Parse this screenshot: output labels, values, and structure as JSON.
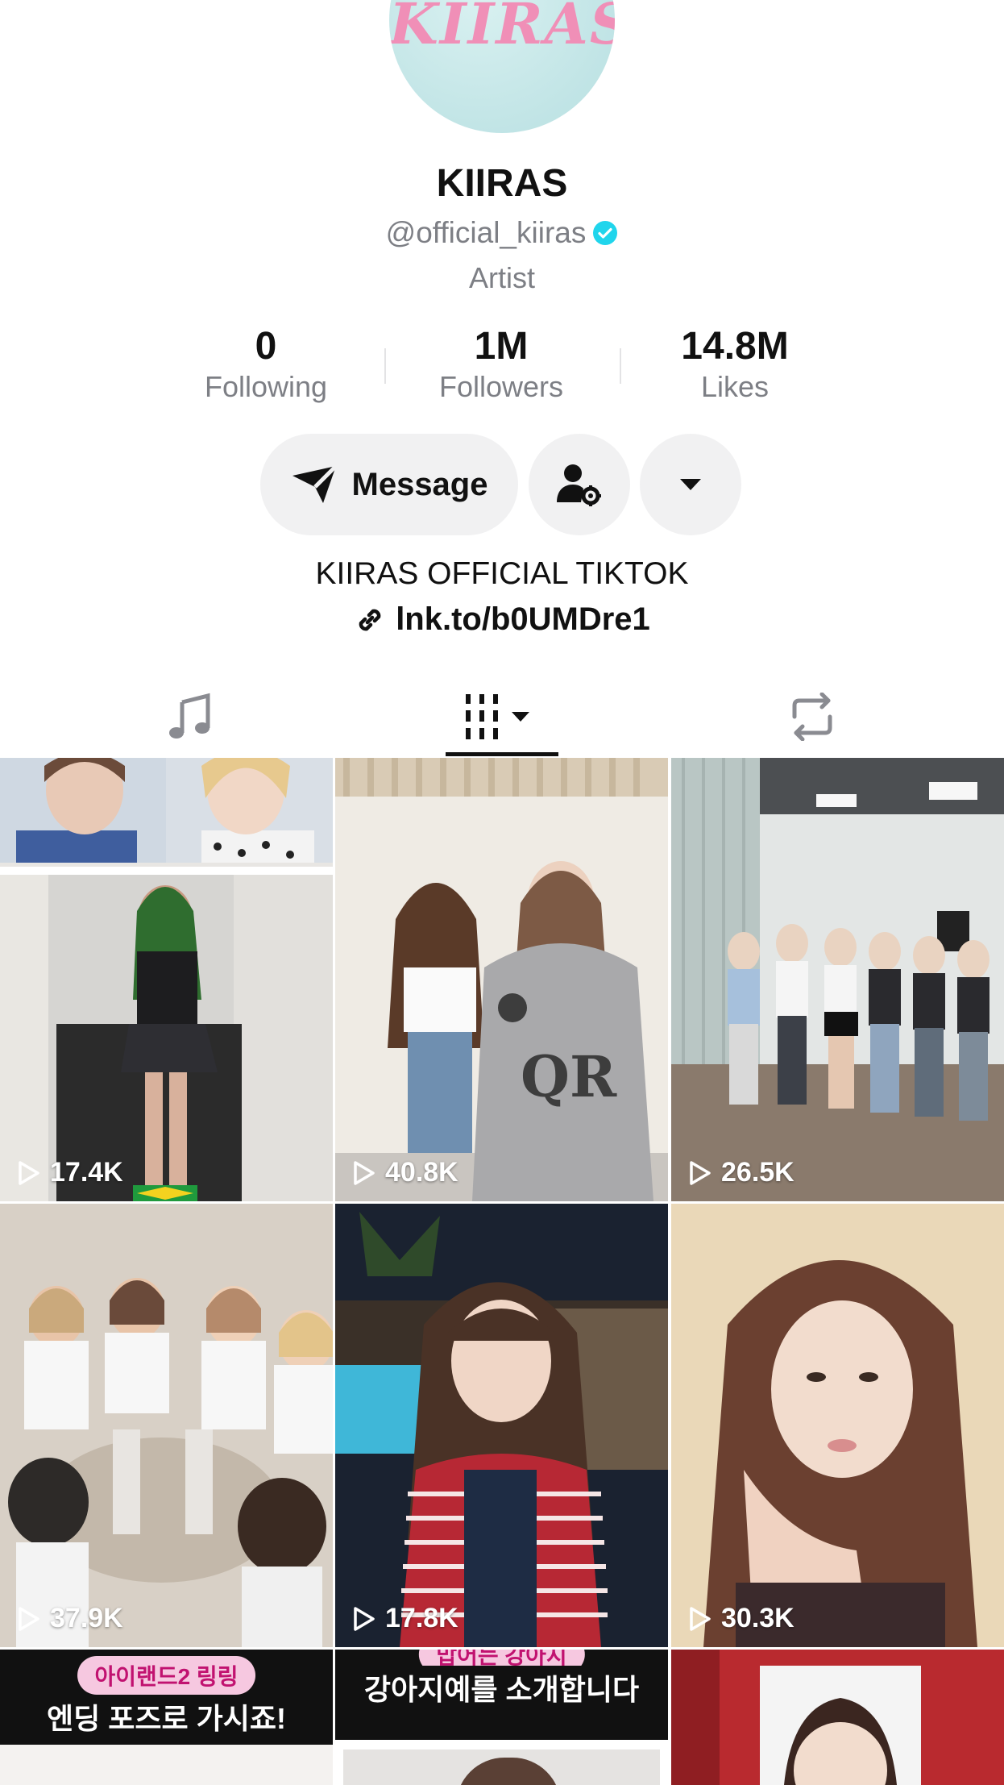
{
  "profile": {
    "avatar_text": "KIIRAS",
    "name": "KIIRAS",
    "handle": "@official_kiiras",
    "category": "Artist",
    "bio": "KIIRAS OFFICIAL TIKTOK",
    "link": "lnk.to/b0UMDre1"
  },
  "stats": [
    {
      "value": "0",
      "label": "Following"
    },
    {
      "value": "1M",
      "label": "Followers"
    },
    {
      "value": "14.8M",
      "label": "Likes"
    }
  ],
  "actions": {
    "message_label": "Message"
  },
  "icons": {
    "verified": "verified-badge-icon",
    "message": "send-icon",
    "add_friend": "user-settings-icon",
    "more": "caret-down-icon",
    "link": "link-icon",
    "tab_music": "music-note-icon",
    "tab_videos": "grid-icon",
    "tab_reposts": "repost-icon",
    "play": "play-icon"
  },
  "colors": {
    "verified": "#20d5ec",
    "button_bg": "#f1f1f2",
    "secondary_text": "#7d7f85"
  },
  "tiles": [
    {
      "views": "17.4K"
    },
    {
      "views": "40.8K"
    },
    {
      "views": "26.5K"
    },
    {
      "views": "37.9K"
    },
    {
      "views": "17.8K"
    },
    {
      "views": "30.3K"
    }
  ],
  "bottom_tiles": [
    {
      "pill": "아이랜드2 링링",
      "caption": "엔딩 포즈로 가시죠!"
    },
    {
      "pill": "맙어는 강아지",
      "caption": "강아지예를 소개합니다"
    }
  ]
}
